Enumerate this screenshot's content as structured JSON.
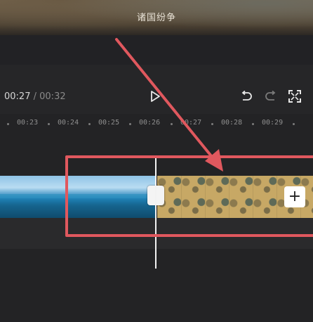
{
  "preview": {
    "subtitle": "诸国纷争"
  },
  "player": {
    "current_time": "00:27",
    "separator": "/",
    "total_time": "00:32"
  },
  "ruler": {
    "labels": [
      "00:23",
      "00:24",
      "00:25",
      "00:26",
      "00:27",
      "00:28",
      "00:29"
    ]
  },
  "timeline": {
    "add_label": "+"
  },
  "annotation": {
    "color": "#e0585e"
  },
  "icons": [
    "play-icon",
    "undo-icon",
    "redo-icon",
    "fullscreen-icon",
    "add-icon"
  ]
}
